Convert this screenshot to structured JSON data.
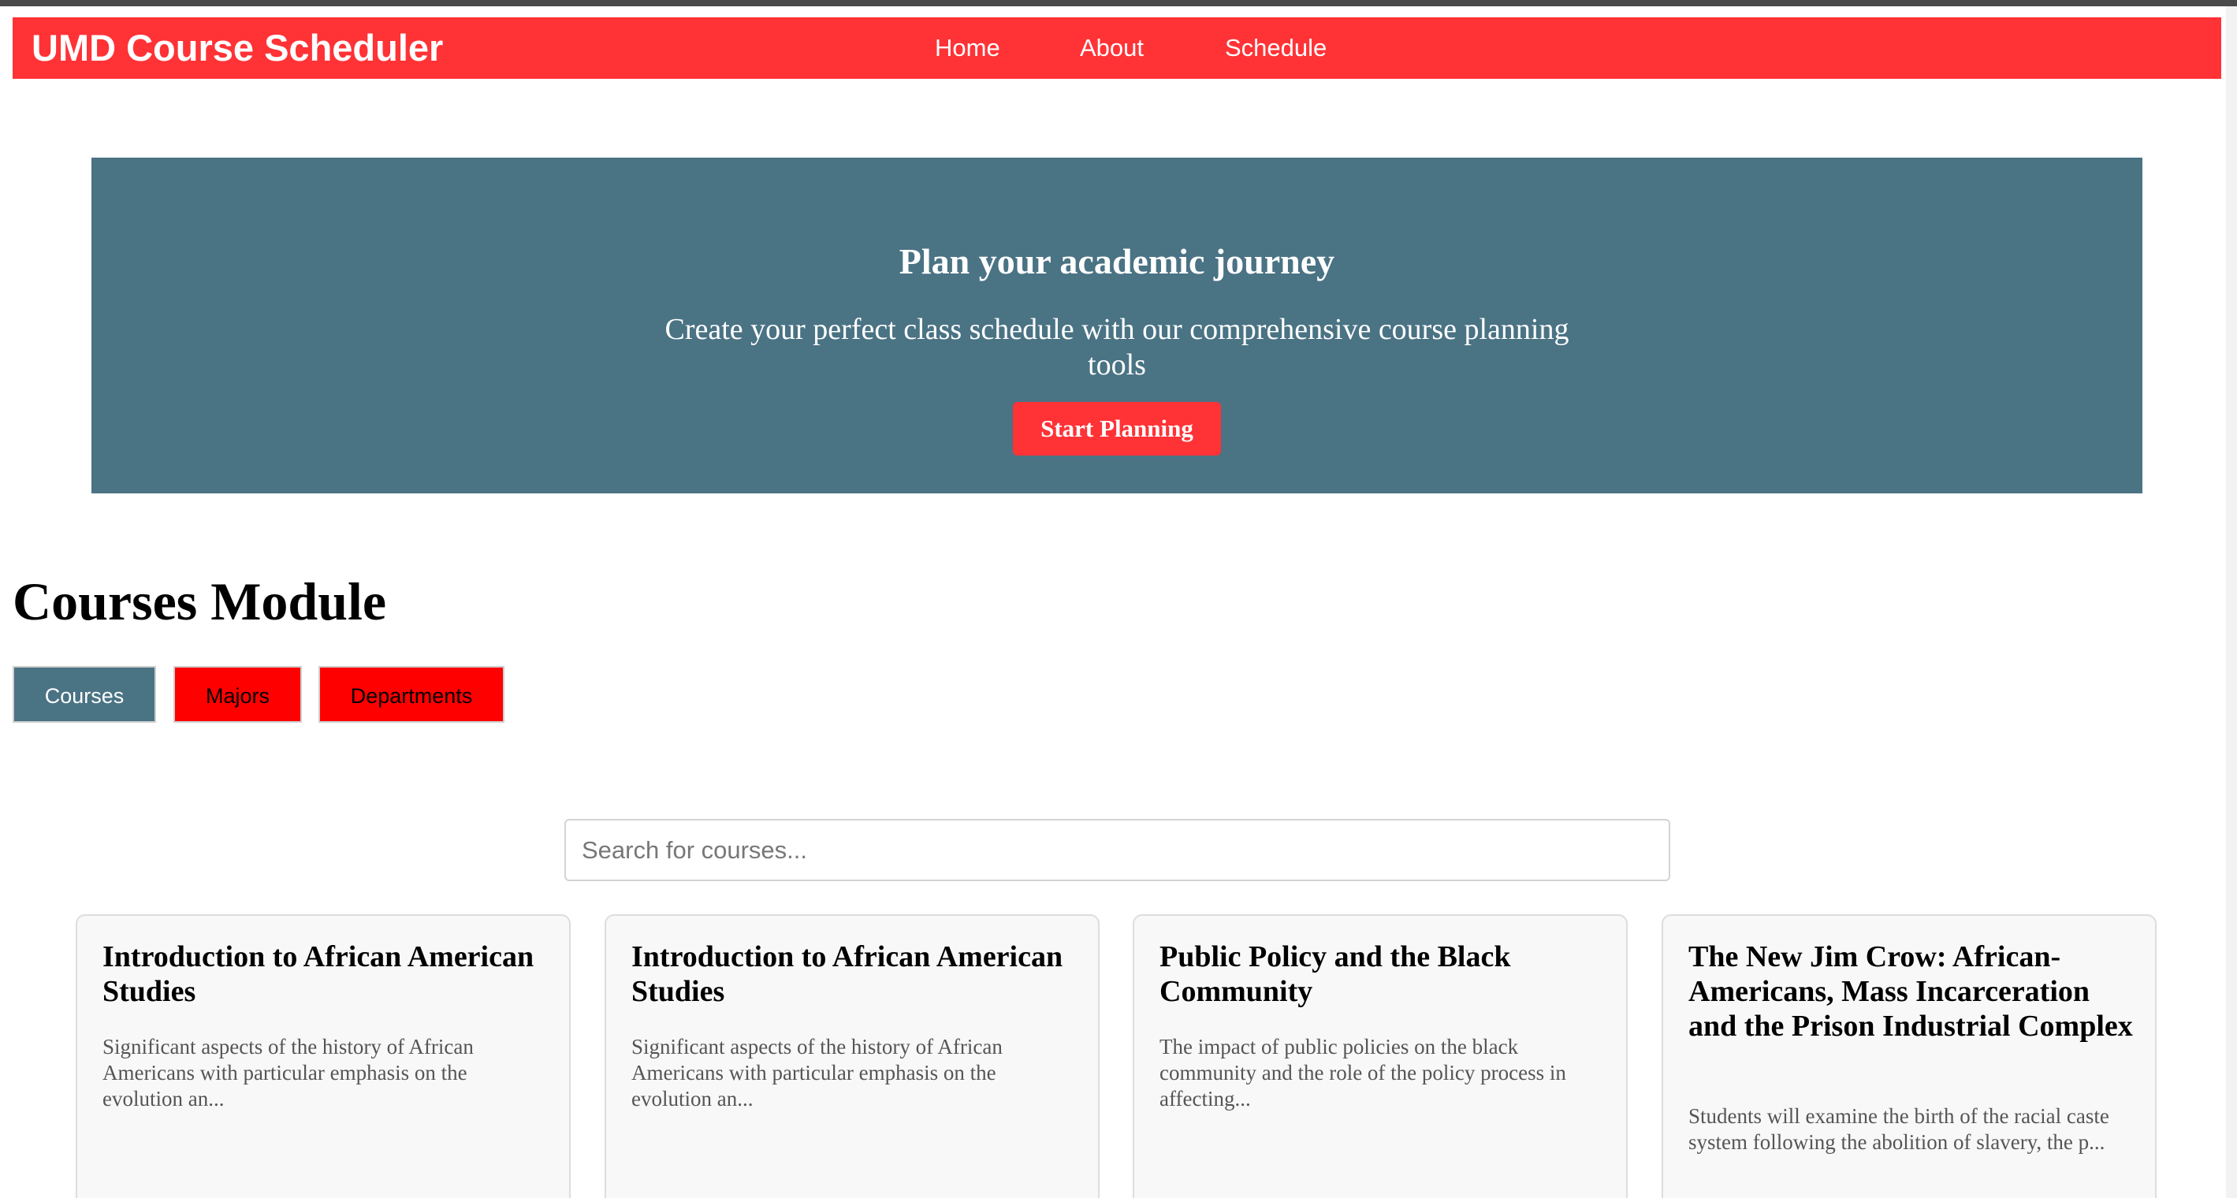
{
  "navbar": {
    "brand": "UMD Course Scheduler",
    "links": [
      "Home",
      "About",
      "Schedule"
    ],
    "background_color": "#ff3236"
  },
  "hero": {
    "title": "Plan your academic journey",
    "subtitle": "Create your perfect class schedule with our comprehensive course planning tools",
    "button_label": "Start Planning",
    "background_color": "#4a7384"
  },
  "module": {
    "title": "Courses Module",
    "tabs": [
      {
        "label": "Courses",
        "active": true
      },
      {
        "label": "Majors",
        "active": false
      },
      {
        "label": "Departments",
        "active": false
      }
    ]
  },
  "search": {
    "placeholder": "Search for courses...",
    "value": ""
  },
  "courses": [
    {
      "title": "Introduction to African American Studies",
      "description": "Significant aspects of the history of African Americans with particular emphasis on the evolution an..."
    },
    {
      "title": "Introduction to African American Studies",
      "description": "Significant aspects of the history of African Americans with particular emphasis on the evolution an..."
    },
    {
      "title": "Public Policy and the Black Community",
      "description": "The impact of public policies on the black community and the role of the policy process in affecting..."
    },
    {
      "title": "The New Jim Crow: African-Americans, Mass Incarceration and the Prison Industrial Complex",
      "description": "Students will examine the birth of the racial caste system following the abolition of slavery, the p..."
    }
  ]
}
